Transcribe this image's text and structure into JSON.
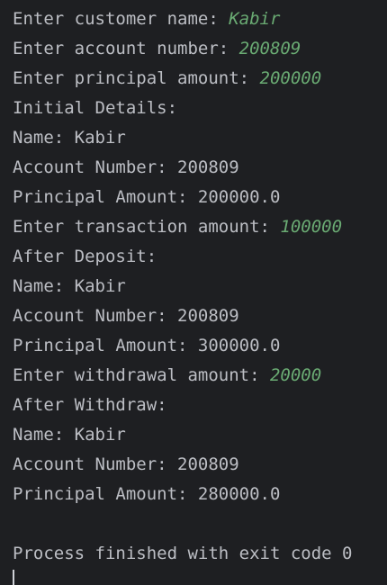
{
  "console": {
    "lines": [
      {
        "text": "Enter customer name: ",
        "input": "Kabir"
      },
      {
        "text": "Enter account number: ",
        "input": "200809"
      },
      {
        "text": "Enter principal amount: ",
        "input": "200000"
      },
      {
        "text": "Initial Details:"
      },
      {
        "text": "Name: Kabir"
      },
      {
        "text": "Account Number: 200809"
      },
      {
        "text": "Principal Amount: 200000.0"
      },
      {
        "text": "Enter transaction amount: ",
        "input": "100000"
      },
      {
        "text": "After Deposit:"
      },
      {
        "text": "Name: Kabir"
      },
      {
        "text": "Account Number: 200809"
      },
      {
        "text": "Principal Amount: 300000.0"
      },
      {
        "text": "Enter withdrawal amount: ",
        "input": "20000"
      },
      {
        "text": "After Withdraw:"
      },
      {
        "text": "Name: Kabir"
      },
      {
        "text": "Account Number: 200809"
      },
      {
        "text": "Principal Amount: 280000.0"
      },
      {
        "text": ""
      },
      {
        "text": "Process finished with exit code 0"
      }
    ]
  },
  "colors": {
    "background": "#1e1f22",
    "output_text": "#bcbec4",
    "user_input": "#6aab73",
    "cursor": "#ced0d6"
  }
}
